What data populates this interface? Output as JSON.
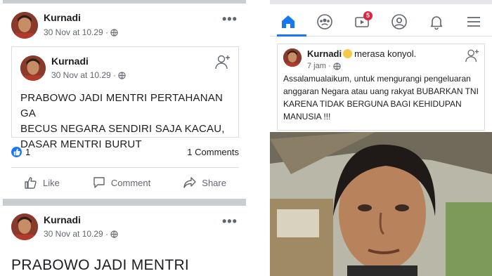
{
  "left_post": {
    "author": "Kurnadi",
    "timestamp": "30 Nov at 10.29 ·",
    "privacy_icon": "globe-icon",
    "more_icon": "more-dots-icon",
    "more_label": "•••",
    "shared": {
      "author": "Kurnadi",
      "timestamp": "30 Nov at 10.29 ·",
      "add_friend_icon": "add-friend-icon",
      "text_lines": [
        "PRABOWO JADI MENTRI PERTAHANAN GA",
        "BECUS NEGARA SENDIRI SAJA KACAU,",
        "DASAR MENTRI BURUT"
      ]
    },
    "reaction_count": "1",
    "comments_count": "1 Comments",
    "actions": {
      "like": "Like",
      "comment": "Comment",
      "share": "Share"
    }
  },
  "left_post_2": {
    "author": "Kurnadi",
    "timestamp": "30 Nov at 10.29 ·",
    "more_label": "•••",
    "text": "PRABOWO JADI MENTRI"
  },
  "right_panel": {
    "nav": {
      "items": [
        "home-icon",
        "groups-icon",
        "watch-icon",
        "profile-icon",
        "notifications-icon",
        "menu-icon"
      ],
      "watch_badge": "5",
      "accent": "#1877f2"
    },
    "post": {
      "author": "Kurnadi",
      "feeling": "merasa konyol.",
      "timestamp": "7 jam ·",
      "text": "Assalamualaikum, untuk mengurangi pengeluaran anggaran Negara atau uang rakyat BUBARKAN TNI KARENA TIDAK BERGUNA BAGI KEHIDUPAN MANUSIA !!!"
    }
  },
  "colors": {
    "brand_blue": "#1877f2",
    "text_gray": "#606770",
    "divider": "#dadde1",
    "badge_red": "#e41e3f"
  }
}
